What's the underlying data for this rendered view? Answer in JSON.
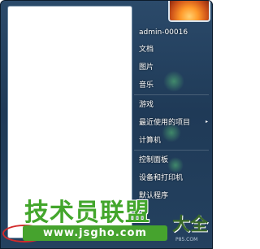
{
  "start_menu": {
    "user_name": "admin-00016",
    "items": [
      {
        "label": "文档"
      },
      {
        "label": "图片"
      },
      {
        "label": "音乐"
      },
      {
        "label": "游戏"
      },
      {
        "label": "最近使用的项目"
      },
      {
        "label": "计算机"
      },
      {
        "label": "控制面板"
      },
      {
        "label": "设备和打印机"
      },
      {
        "label": "默认程序"
      }
    ],
    "submenu_arrow": "▸"
  },
  "watermark": {
    "brand": "技术员联盟",
    "brand_suffix": "大全",
    "url": "www.jsgho.com",
    "small_url": "P85.COM"
  },
  "colors": {
    "menu_blue": "#24415f",
    "watermark_green": "#43a62c",
    "highlight_red": "#d22a2a"
  }
}
